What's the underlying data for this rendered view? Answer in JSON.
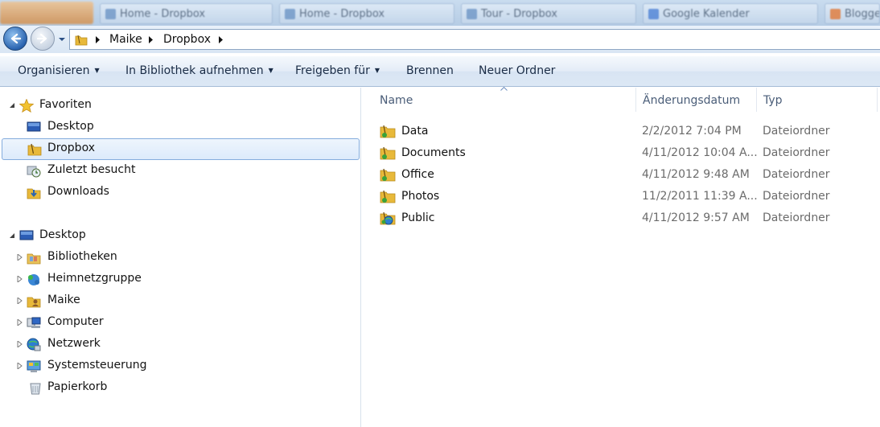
{
  "taskbar": {
    "tabs": [
      {
        "label": "Home - Dropbox"
      },
      {
        "label": "Home - Dropbox"
      },
      {
        "label": "Tour - Dropbox"
      },
      {
        "label": "Google Kalender"
      },
      {
        "label": "Blogger"
      }
    ]
  },
  "address": {
    "breadcrumbs": [
      "Maike",
      "Dropbox"
    ]
  },
  "toolbar": {
    "organize": "Organisieren",
    "library": "In Bibliothek aufnehmen",
    "share": "Freigeben für",
    "burn": "Brennen",
    "new_folder": "Neuer Ordner"
  },
  "nav": {
    "favorites_header": "Favoriten",
    "favorites": [
      {
        "label": "Desktop",
        "icon": "desktop-icon"
      },
      {
        "label": "Dropbox",
        "icon": "dropbox-folder-icon",
        "selected": true
      },
      {
        "label": "Zuletzt besucht",
        "icon": "recent-places-icon"
      },
      {
        "label": "Downloads",
        "icon": "downloads-icon"
      }
    ],
    "desktop_header": "Desktop",
    "tree": [
      {
        "label": "Bibliotheken",
        "icon": "libraries-icon"
      },
      {
        "label": "Heimnetzgruppe",
        "icon": "homegroup-icon"
      },
      {
        "label": "Maike",
        "icon": "user-folder-icon"
      },
      {
        "label": "Computer",
        "icon": "computer-icon"
      },
      {
        "label": "Netzwerk",
        "icon": "network-icon"
      },
      {
        "label": "Systemsteuerung",
        "icon": "control-panel-icon"
      },
      {
        "label": "Papierkorb",
        "icon": "recycle-bin-icon"
      }
    ]
  },
  "columns": {
    "name": "Name",
    "date": "Änderungsdatum",
    "type": "Typ"
  },
  "files": [
    {
      "name": "Data",
      "date": "2/2/2012 7:04 PM",
      "type": "Dateiordner",
      "icon": "synced-folder-icon"
    },
    {
      "name": "Documents",
      "date": "4/11/2012 10:04 A...",
      "type": "Dateiordner",
      "icon": "synced-folder-icon"
    },
    {
      "name": "Office",
      "date": "4/11/2012 9:48 AM",
      "type": "Dateiordner",
      "icon": "synced-folder-icon"
    },
    {
      "name": "Photos",
      "date": "11/2/2011 11:39 A...",
      "type": "Dateiordner",
      "icon": "synced-folder-icon"
    },
    {
      "name": "Public",
      "date": "4/11/2012 9:57 AM",
      "type": "Dateiordner",
      "icon": "public-folder-icon"
    }
  ],
  "colors": {
    "accent": "#2a64b0",
    "selection_border": "#84acdd",
    "folder": "#e8b93a",
    "sync_badge": "#3aa33a"
  }
}
